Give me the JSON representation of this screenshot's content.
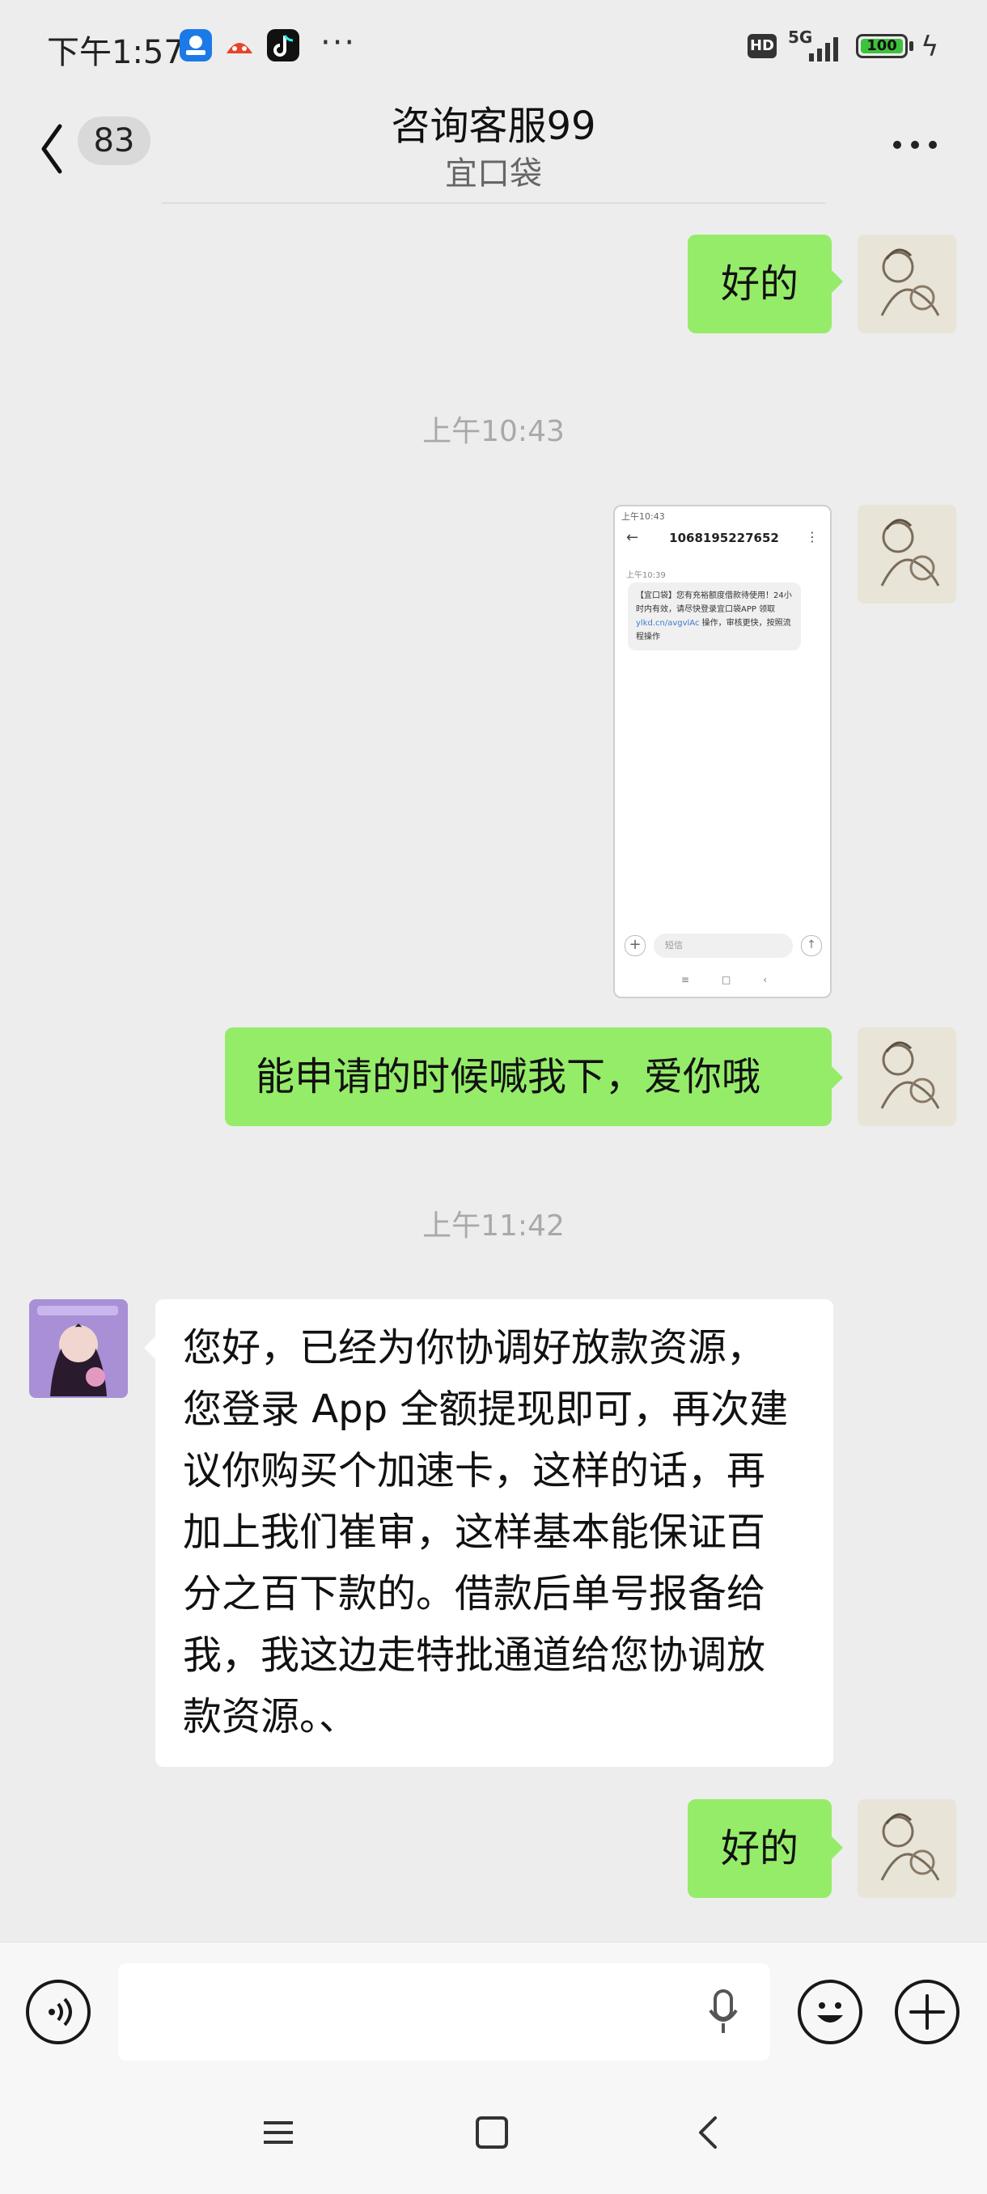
{
  "status_bar": {
    "time": "下午1:57",
    "more_indicator": "···",
    "network_badge": "HD",
    "network_type": "5G",
    "battery_level": "100",
    "app_icons": [
      "wechat-pay-icon",
      "red-app-icon",
      "tiktok-icon"
    ]
  },
  "header": {
    "unread_count": "83",
    "title": "咨询客服99",
    "subtitle": "宜口袋"
  },
  "messages": [
    {
      "side": "out",
      "text": "好的"
    },
    {
      "timestamp": "上午10:43"
    },
    {
      "side": "out",
      "type": "image",
      "embedded": {
        "status": "上午10:43",
        "phone_number": "1068195227652",
        "time": "上午10:39",
        "sms_text": "【宜口袋】您有充裕额度借款待使用！24小时内有效，请尽快登录宜口袋APP 领取",
        "sms_link": "ylkd.cn/avgvlAc",
        "sms_tail": "操作，审核更快，按照流程操作",
        "input_placeholder": "短信"
      }
    },
    {
      "side": "out",
      "text": "能申请的时候喊我下，爱你哦"
    },
    {
      "timestamp": "上午11:42"
    },
    {
      "side": "in",
      "text_lines": [
        "您好，已经为你协调好放款资源，",
        "您登录 App 全额提现即可，再次建",
        "议你购买个加速卡，这样的话，再",
        "加上我们崔审，这样基本能保证百",
        "分之百下款的。借款后单号报备给",
        "我，我这边走特批通道给您协调放",
        "款资源。、"
      ]
    },
    {
      "side": "out",
      "text": "好的"
    }
  ],
  "input_bar": {
    "voice_icon": "voice-mode-icon",
    "mic_icon": "microphone-icon",
    "emoji_icon": "emoji-icon",
    "plus_icon": "plus-icon"
  },
  "colors": {
    "background": "#ededed",
    "outgoing_bubble": "#95ec69",
    "incoming_bubble": "#ffffff"
  }
}
